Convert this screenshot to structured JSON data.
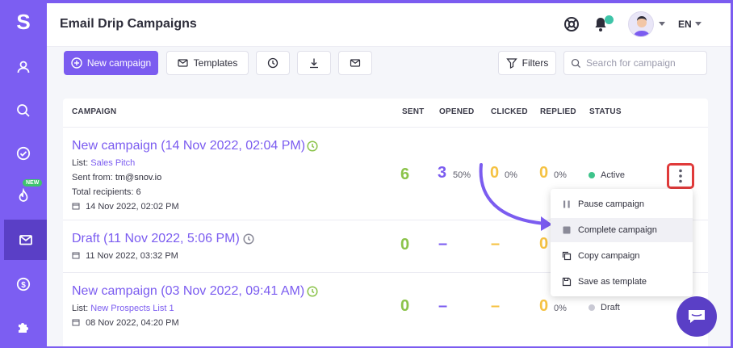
{
  "app": {
    "logo": "S"
  },
  "sidebar": {
    "new_badge": "NEW"
  },
  "header": {
    "title": "Email Drip Campaigns",
    "lang": "EN"
  },
  "toolbar": {
    "new_campaign": "New campaign",
    "templates": "Templates",
    "filters": "Filters",
    "search_placeholder": "Search for campaign"
  },
  "table": {
    "headers": [
      "CAMPAIGN",
      "SENT",
      "OPENED",
      "CLICKED",
      "REPLIED",
      "STATUS"
    ],
    "rows": [
      {
        "title": "New campaign (14 Nov 2022, 02:04 PM)",
        "list_label": "List:",
        "list_name": "Sales Pitch",
        "sent_from_label": "Sent from:",
        "sent_from": "tm@snov.io",
        "recipients_label": "Total recipients:",
        "recipients": "6",
        "date": "14 Nov 2022, 02:02 PM",
        "sent": "6",
        "opened": "3",
        "opened_pct": "50%",
        "clicked": "0",
        "clicked_pct": "0%",
        "replied": "0",
        "replied_pct": "0%",
        "status": "Active"
      },
      {
        "title": "Draft (11 Nov 2022, 5:06 PM)",
        "date": "11 Nov 2022, 03:32 PM",
        "sent": "0",
        "opened": "–",
        "clicked": "–",
        "replied": "0"
      },
      {
        "title": "New campaign (03 Nov 2022, 09:41 AM)",
        "list_label": "List:",
        "list_name": "New Prospects List 1",
        "date": "08 Nov 2022, 04:20 PM",
        "sent": "0",
        "opened": "–",
        "clicked": "–",
        "replied": "0",
        "replied_pct": "0%",
        "status": "Draft"
      }
    ]
  },
  "menu": {
    "items": [
      "Pause campaign",
      "Complete campaign",
      "Copy campaign",
      "Save as template"
    ]
  },
  "colors": {
    "accent": "#7b5cf0",
    "green": "#8bc34a",
    "yellow": "#f5c242",
    "active": "#3ec48b",
    "highlight": "#e03a3a"
  }
}
